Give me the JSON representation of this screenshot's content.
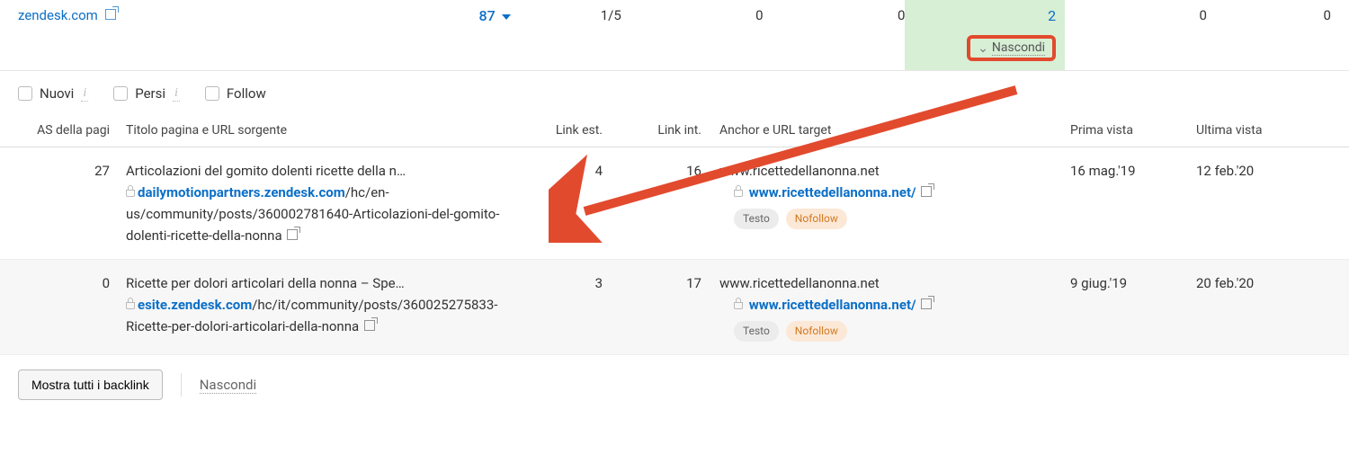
{
  "top": {
    "domain": "zendesk.com",
    "as": "87",
    "col1": "1/5",
    "col2": "0",
    "col3": "0",
    "col_highlight": "2",
    "col5": "0",
    "col6": "0",
    "nascondi_label": "Nascondi"
  },
  "filters": {
    "nuovi": "Nuovi",
    "persi": "Persi",
    "follow": "Follow"
  },
  "headers": {
    "as": "AS della pagi",
    "title": "Titolo pagina e URL sorgente",
    "lest": "Link est.",
    "lint": "Link int.",
    "anchor": "Anchor e URL target",
    "prima": "Prima vista",
    "ultima": "Ultima vista"
  },
  "rows": [
    {
      "as": "27",
      "title": "Articolazioni del gomito dolenti ricette della n…",
      "url_bold": "dailymotionpartners.zendesk.com",
      "url_rest": "/hc/en-us/community/posts/360002781640-Articolazioni-del-gomito-dolenti-ricette-della-nonna",
      "lest": "4",
      "lint": "16",
      "anchor_text": "www.ricettedellanonna.net",
      "anchor_url": "www.ricettedellanonna.net/",
      "tag1": "Testo",
      "tag2": "Nofollow",
      "prima": "16 mag.'19",
      "ultima": "12 feb.'20"
    },
    {
      "as": "0",
      "title": "Ricette per dolori articolari della nonna – Spe…",
      "url_bold": "esite.zendesk.com",
      "url_rest": "/hc/it/community/posts/360025275833-Ricette-per-dolori-articolari-della-nonna",
      "lest": "3",
      "lint": "17",
      "anchor_text": "www.ricettedellanonna.net",
      "anchor_url": "www.ricettedellanonna.net/",
      "tag1": "Testo",
      "tag2": "Nofollow",
      "prima": "9 giug.'19",
      "ultima": "20 feb.'20"
    }
  ],
  "footer": {
    "show_all": "Mostra tutti i backlink",
    "hide": "Nascondi"
  }
}
